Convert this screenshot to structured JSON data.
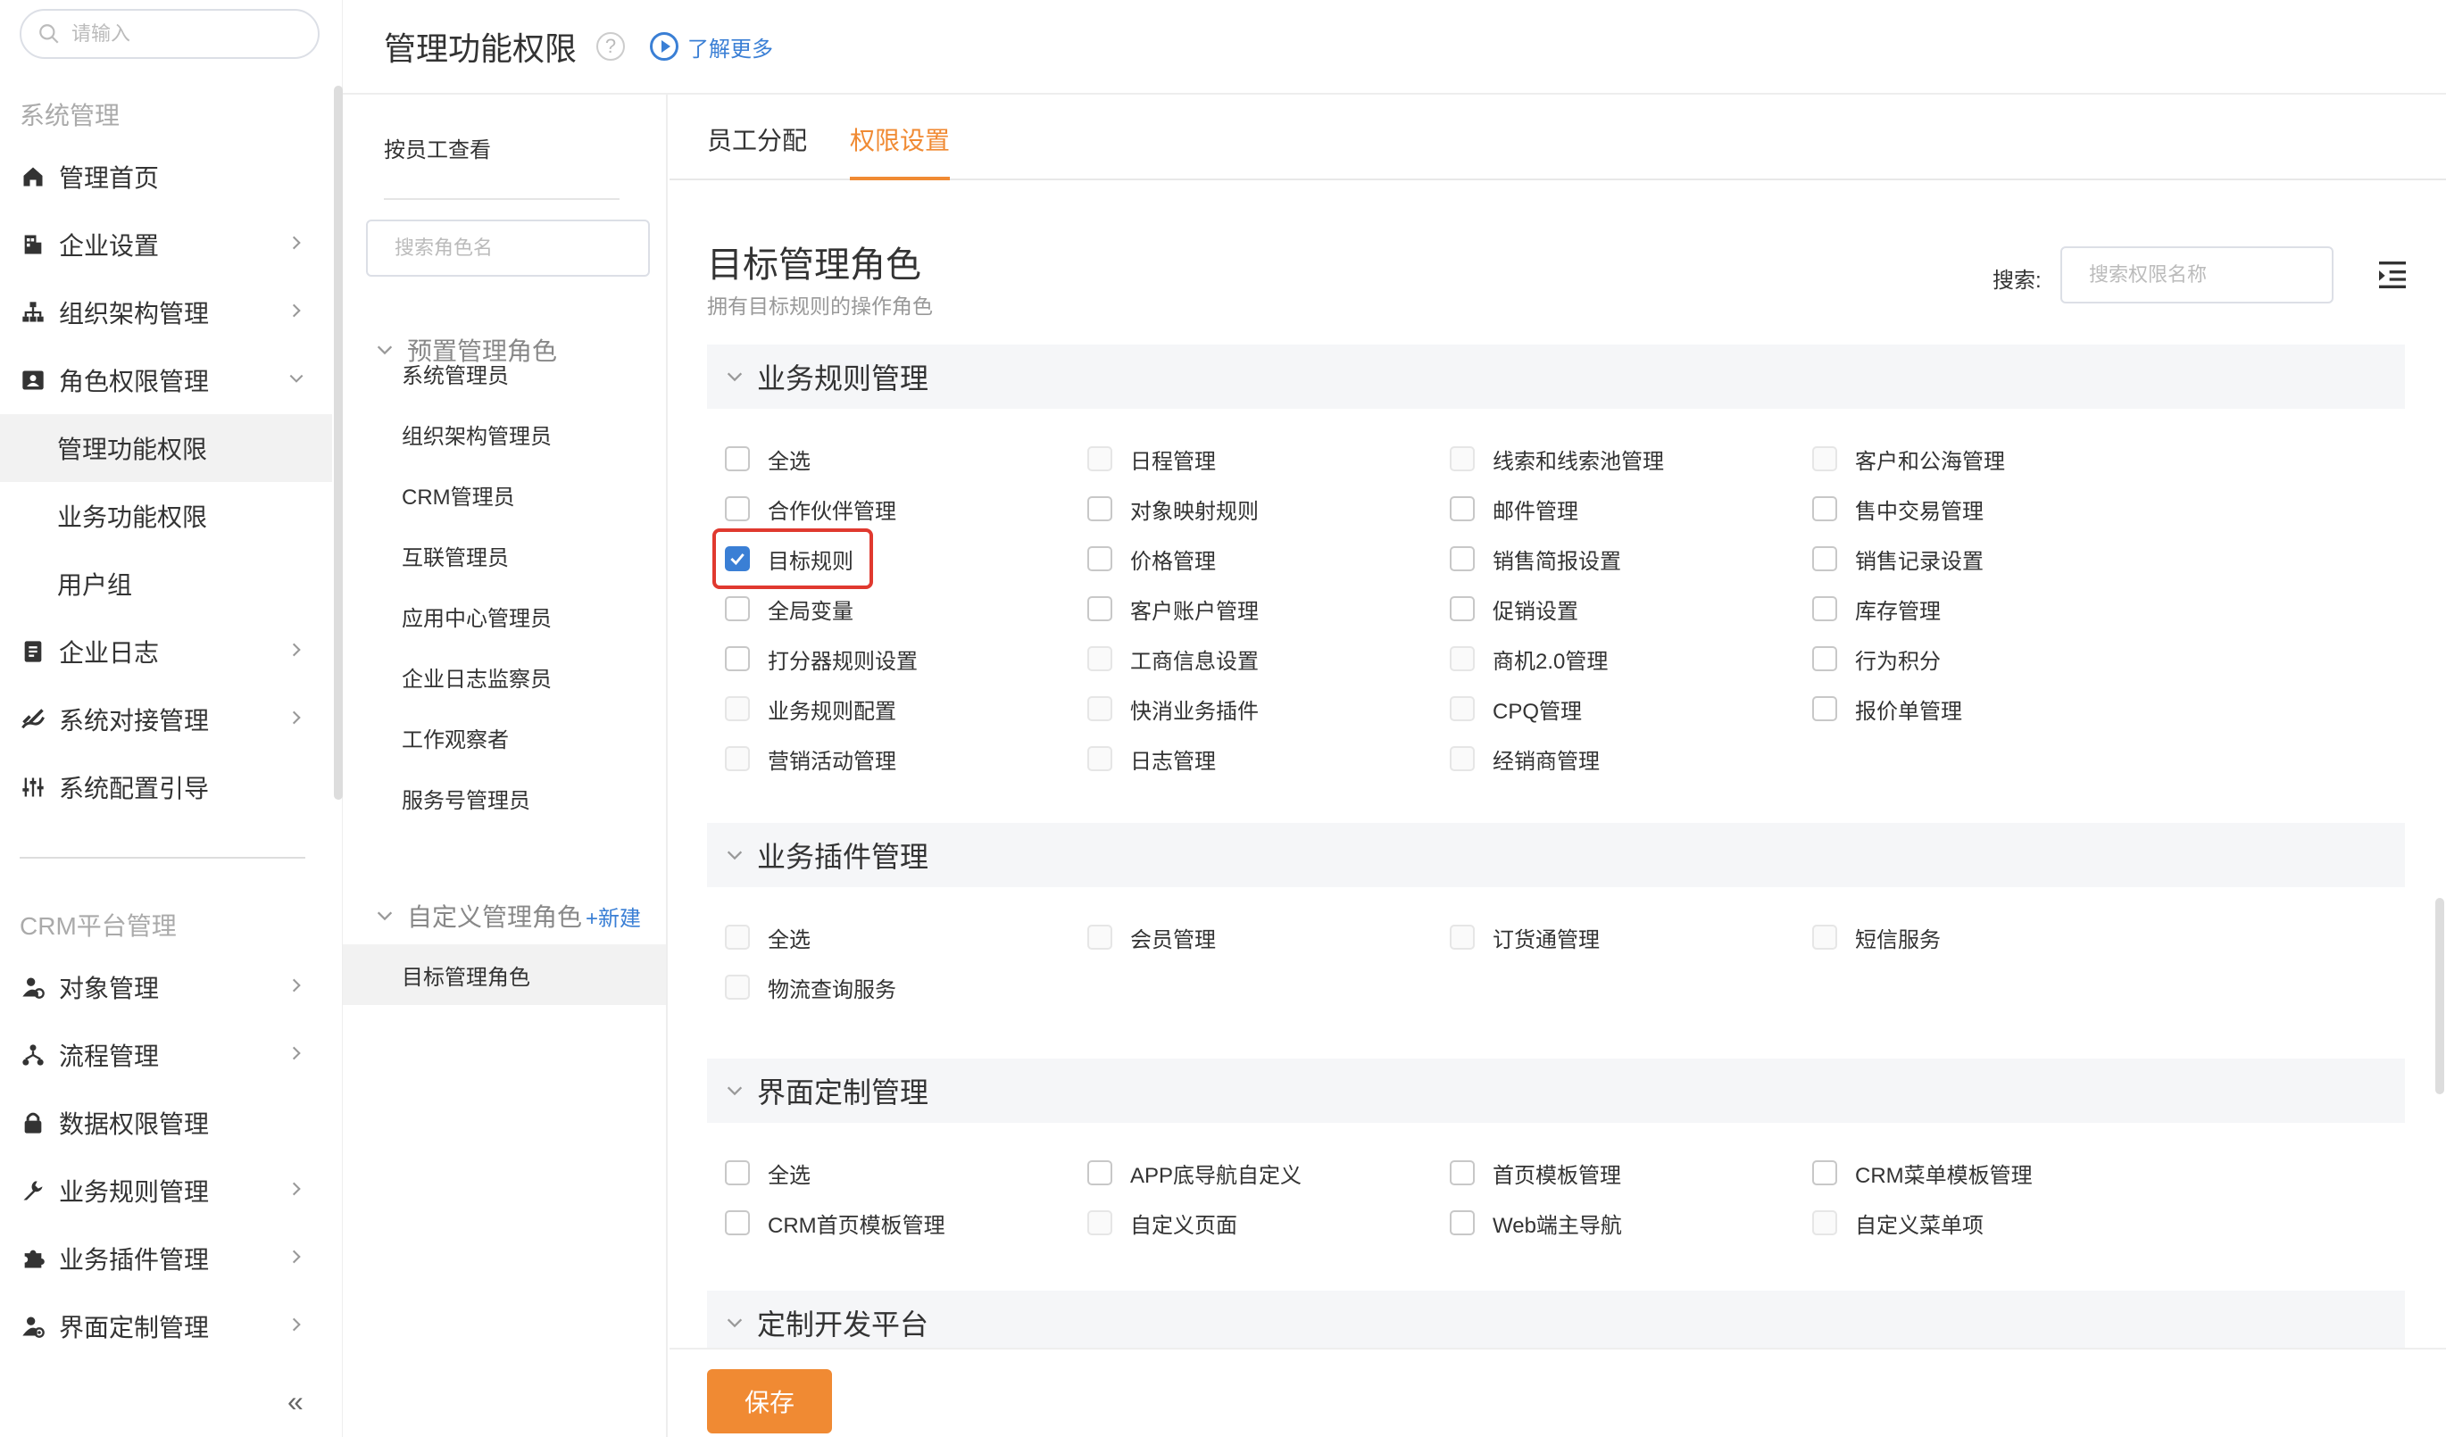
{
  "sidebar": {
    "search_placeholder": "请输入",
    "group_system": "系统管理",
    "group_crm": "CRM平台管理",
    "items": [
      {
        "label": "管理首页",
        "icon": "home-icon"
      },
      {
        "label": "企业设置",
        "icon": "building-icon"
      },
      {
        "label": "组织架构管理",
        "icon": "org-chart-icon"
      },
      {
        "label": "角色权限管理",
        "icon": "id-card-icon"
      },
      {
        "label": "管理功能权限"
      },
      {
        "label": "业务功能权限"
      },
      {
        "label": "用户组"
      },
      {
        "label": "企业日志",
        "icon": "log-icon"
      },
      {
        "label": "系统对接管理",
        "icon": "link-icon"
      },
      {
        "label": "系统配置引导",
        "icon": "sliders-icon"
      }
    ],
    "crm_items": [
      {
        "label": "对象管理",
        "icon": "object-icon"
      },
      {
        "label": "流程管理",
        "icon": "flow-icon"
      },
      {
        "label": "数据权限管理",
        "icon": "lock-icon"
      },
      {
        "label": "业务规则管理",
        "icon": "wrench-icon"
      },
      {
        "label": "业务插件管理",
        "icon": "puzzle-icon"
      },
      {
        "label": "界面定制管理",
        "icon": "ui-custom-icon"
      }
    ],
    "collapse_glyph": "«"
  },
  "header": {
    "title": "管理功能权限",
    "help_glyph": "?",
    "learn_more": "了解更多"
  },
  "roles": {
    "view_by": "按员工查看",
    "search_placeholder": "搜索角色名",
    "preset_group": "预置管理角色",
    "preset_roles": [
      "系统管理员",
      "组织架构管理员",
      "CRM管理员",
      "互联管理员",
      "应用中心管理员",
      "企业日志监察员",
      "工作观察者",
      "服务号管理员"
    ],
    "custom_group": "自定义管理角色",
    "new_link": "+新建",
    "custom_roles": [
      "目标管理角色"
    ]
  },
  "main": {
    "tabs": [
      {
        "label": "员工分配",
        "active": false
      },
      {
        "label": "权限设置",
        "active": true
      }
    ],
    "role_title": "目标管理角色",
    "role_desc": "拥有目标规则的操作角色",
    "search_label": "搜索:",
    "search_placeholder": "搜索权限名称",
    "save_label": "保存",
    "accent_color": "#f08a33",
    "check_color": "#3a7fd5",
    "sections": [
      {
        "title": "业务规则管理",
        "items": [
          {
            "label": "全选",
            "state": "off"
          },
          {
            "label": "日程管理",
            "state": "disabled"
          },
          {
            "label": "线索和线索池管理",
            "state": "disabled"
          },
          {
            "label": "客户和公海管理",
            "state": "disabled"
          },
          {
            "label": "合作伙伴管理",
            "state": "off"
          },
          {
            "label": "对象映射规则",
            "state": "off"
          },
          {
            "label": "邮件管理",
            "state": "off"
          },
          {
            "label": "售中交易管理",
            "state": "off"
          },
          {
            "label": "目标规则",
            "state": "checked"
          },
          {
            "label": "价格管理",
            "state": "off"
          },
          {
            "label": "销售简报设置",
            "state": "off"
          },
          {
            "label": "销售记录设置",
            "state": "off"
          },
          {
            "label": "全局变量",
            "state": "off"
          },
          {
            "label": "客户账户管理",
            "state": "off"
          },
          {
            "label": "促销设置",
            "state": "off"
          },
          {
            "label": "库存管理",
            "state": "off"
          },
          {
            "label": "打分器规则设置",
            "state": "off"
          },
          {
            "label": "工商信息设置",
            "state": "disabled"
          },
          {
            "label": "商机2.0管理",
            "state": "disabled"
          },
          {
            "label": "行为积分",
            "state": "off"
          },
          {
            "label": "业务规则配置",
            "state": "disabled"
          },
          {
            "label": "快消业务插件",
            "state": "disabled"
          },
          {
            "label": "CPQ管理",
            "state": "disabled"
          },
          {
            "label": "报价单管理",
            "state": "off"
          },
          {
            "label": "营销活动管理",
            "state": "disabled"
          },
          {
            "label": "日志管理",
            "state": "disabled"
          },
          {
            "label": "经销商管理",
            "state": "disabled"
          }
        ]
      },
      {
        "title": "业务插件管理",
        "items": [
          {
            "label": "全选",
            "state": "disabled"
          },
          {
            "label": "会员管理",
            "state": "disabled"
          },
          {
            "label": "订货通管理",
            "state": "disabled"
          },
          {
            "label": "短信服务",
            "state": "disabled"
          },
          {
            "label": "物流查询服务",
            "state": "disabled"
          }
        ]
      },
      {
        "title": "界面定制管理",
        "items": [
          {
            "label": "全选",
            "state": "off"
          },
          {
            "label": "APP底导航自定义",
            "state": "off"
          },
          {
            "label": "首页模板管理",
            "state": "off"
          },
          {
            "label": "CRM菜单模板管理",
            "state": "off"
          },
          {
            "label": "CRM首页模板管理",
            "state": "off"
          },
          {
            "label": "自定义页面",
            "state": "disabled"
          },
          {
            "label": "Web端主导航",
            "state": "off"
          },
          {
            "label": "自定义菜单项",
            "state": "disabled"
          }
        ]
      },
      {
        "title": "定制开发平台",
        "items": []
      }
    ]
  }
}
